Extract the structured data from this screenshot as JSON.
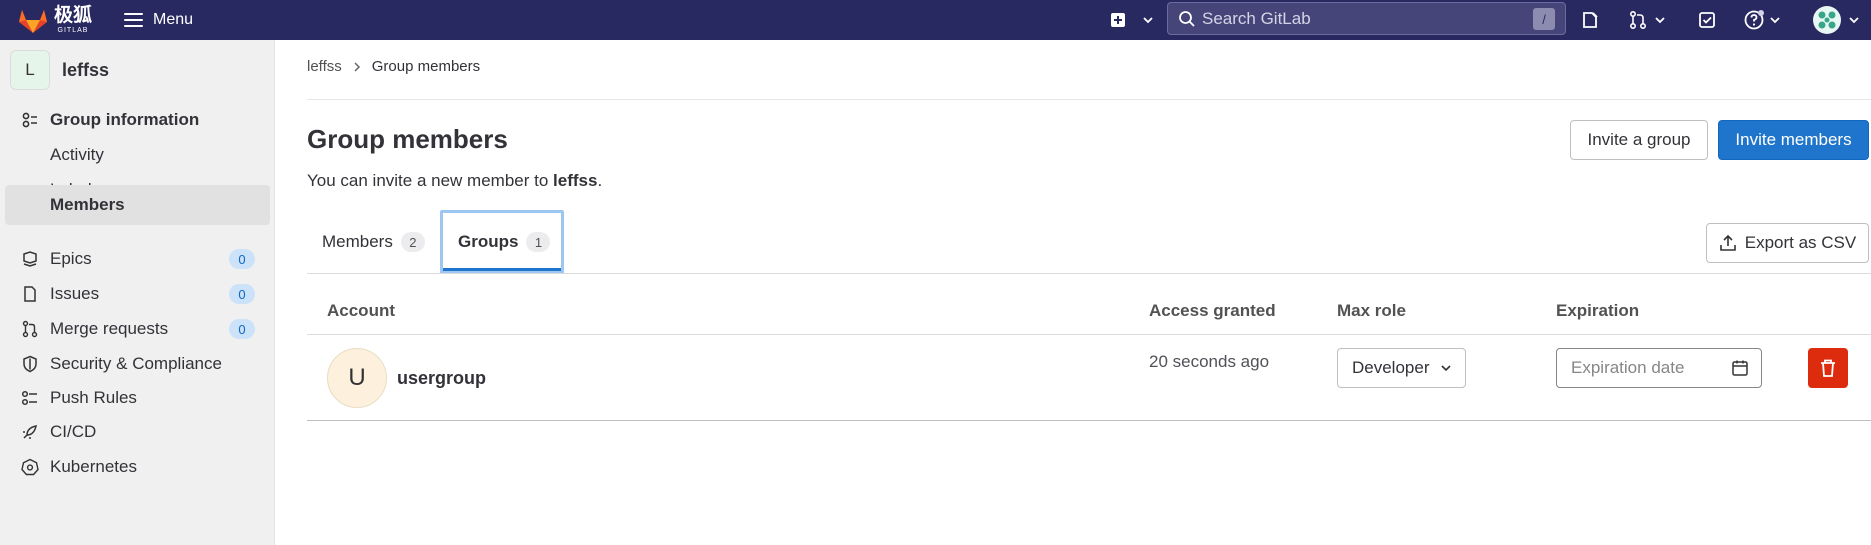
{
  "topbar": {
    "brand_cn": "极狐",
    "brand_en": "GITLAB",
    "menu_label": "Menu",
    "search_placeholder": "Search GitLab",
    "search_shortcut": "/"
  },
  "sidebar": {
    "context_initial": "L",
    "context_name": "leffss",
    "items": [
      {
        "label": "Group information",
        "icon": "group-info-icon"
      },
      {
        "label": "Activity"
      },
      {
        "label": "Labels"
      },
      {
        "label": "Members"
      },
      {
        "label": "Epics",
        "icon": "epic-icon",
        "count": "0"
      },
      {
        "label": "Issues",
        "icon": "issues-icon",
        "count": "0"
      },
      {
        "label": "Merge requests",
        "icon": "merge-request-icon",
        "count": "0"
      },
      {
        "label": "Security & Compliance",
        "icon": "shield-icon"
      },
      {
        "label": "Push Rules",
        "icon": "push-rules-icon"
      },
      {
        "label": "CI/CD",
        "icon": "rocket-icon"
      },
      {
        "label": "Kubernetes",
        "icon": "kubernetes-icon"
      }
    ]
  },
  "breadcrumb": {
    "parent": "leffss",
    "current": "Group members"
  },
  "page": {
    "title": "Group members",
    "subtitle_prefix": "You can invite a new member to ",
    "subtitle_group": "leffss",
    "subtitle_suffix": ".",
    "invite_group_label": "Invite a group",
    "invite_members_label": "Invite members",
    "export_label": "Export as CSV"
  },
  "tabs": [
    {
      "label": "Members",
      "count": "2"
    },
    {
      "label": "Groups",
      "count": "1",
      "active": true
    }
  ],
  "table": {
    "headers": [
      "Account",
      "Access granted",
      "Max role",
      "Expiration"
    ],
    "rows": [
      {
        "avatar_initial": "U",
        "name": "usergroup",
        "access_granted": "20 seconds ago",
        "max_role": "Developer",
        "expiration_placeholder": "Expiration date"
      }
    ]
  },
  "colors": {
    "topbar": "#292961",
    "primary": "#1f75cb",
    "danger": "#dd2b0e"
  }
}
